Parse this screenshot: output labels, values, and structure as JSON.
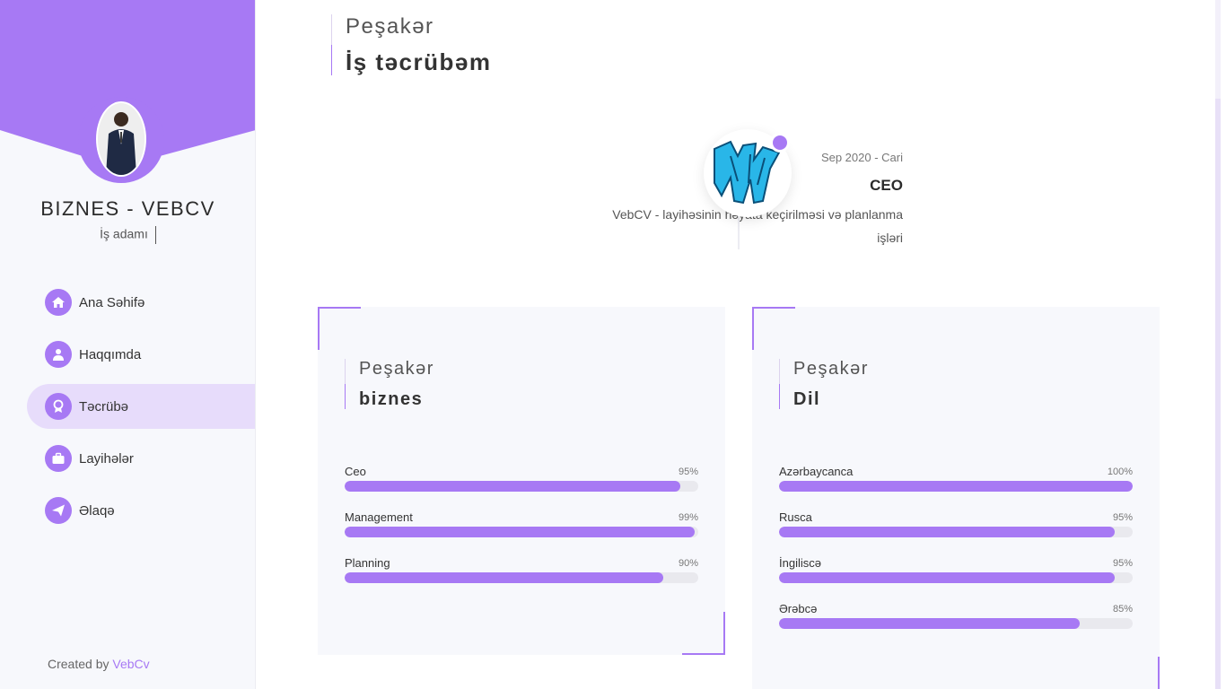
{
  "colors": {
    "accent": "#a779f4",
    "accent_light": "#e7dcfb",
    "sidebar_bg": "#f7f8fc"
  },
  "sidebar": {
    "name": "BIZNES - VEBCV",
    "role": "İş adamı",
    "nav": [
      {
        "label": "Ana Səhifə",
        "icon": "home-icon",
        "active": false
      },
      {
        "label": "Haqqımda",
        "icon": "user-icon",
        "active": false
      },
      {
        "label": "Təcrübə",
        "icon": "award-icon",
        "active": true
      },
      {
        "label": "Layihələr",
        "icon": "briefcase-icon",
        "active": false
      },
      {
        "label": "Əlaqə",
        "icon": "send-icon",
        "active": false
      }
    ],
    "footer": {
      "prefix": "Created by ",
      "link": "VebCv"
    }
  },
  "main": {
    "section": {
      "kicker": "Peşakər",
      "heading": "İş təcrübəm"
    },
    "timeline": [
      {
        "date": "Sep 2020 - Cari",
        "title": "CEO",
        "description": "VebCV - layihəsinin həyata keçirilməsi və planlanma işləri"
      }
    ],
    "cards": [
      {
        "kicker": "Peşakər",
        "heading": "biznes",
        "skills": [
          {
            "name": "Ceo",
            "percent_label": "95%",
            "value": 95
          },
          {
            "name": "Management",
            "percent_label": "99%",
            "value": 99
          },
          {
            "name": "Planning",
            "percent_label": "90%",
            "value": 90
          }
        ]
      },
      {
        "kicker": "Peşakər",
        "heading": "Dil",
        "skills": [
          {
            "name": "Azərbaycanca",
            "percent_label": "100%",
            "value": 100
          },
          {
            "name": "Rusca",
            "percent_label": "95%",
            "value": 95
          },
          {
            "name": "İngiliscə",
            "percent_label": "95%",
            "value": 95
          },
          {
            "name": "Ərəbcə",
            "percent_label": "85%",
            "value": 85
          }
        ]
      }
    ]
  }
}
